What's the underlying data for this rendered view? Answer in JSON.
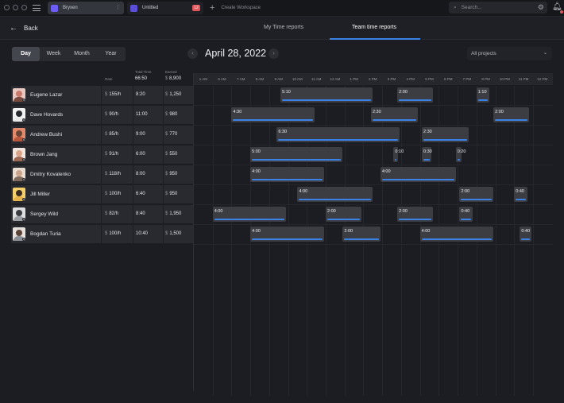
{
  "app": {
    "active_tab": "Bryxen",
    "other_tab": "Untitled",
    "other_tab_badge": "12",
    "create_workspace": "Create Workspace",
    "search_placeholder": "Search...",
    "colors": {
      "accent": "#3b82e6",
      "brand": "#6d5df5",
      "badge": "#e0565b"
    }
  },
  "nav": {
    "back_label": "Back",
    "tabs": [
      "My Time reports",
      "Team time reports"
    ],
    "active_tab": "Team time reports"
  },
  "controls": {
    "periods": [
      "Day",
      "Week",
      "Month",
      "Year"
    ],
    "active_period": "Day",
    "date": "April 28, 2022",
    "prev_icon": "chevron-left-icon",
    "next_icon": "chevron-right-icon",
    "project_filter": "All projects"
  },
  "table": {
    "headers": {
      "rate": "Rate",
      "total_time": "Total Time",
      "earned": "Earned"
    },
    "totals": {
      "total_time": "66:50",
      "earned_currency": "$",
      "earned": "8,900"
    },
    "currency": "$",
    "rows": [
      {
        "name": "Eugene Lazar",
        "rate": "155/h",
        "time": "8:20",
        "earned": "1,250",
        "avatar_colors": [
          "#c97a6a",
          "#7a4a3e",
          "#e8c8c0"
        ]
      },
      {
        "name": "Dave Hovards",
        "rate": "90/h",
        "time": "11:00",
        "earned": "980",
        "avatar_colors": [
          "#2a2b30",
          "#e9e9ea",
          "#f2f2f2"
        ]
      },
      {
        "name": "Andrew Bushi",
        "rate": "85/h",
        "time": "9:00",
        "earned": "770",
        "avatar_colors": [
          "#6a4536",
          "#b8573c",
          "#e38a6c"
        ]
      },
      {
        "name": "Brown Jang",
        "rate": "91/h",
        "time": "6:00",
        "earned": "550",
        "avatar_colors": [
          "#d9a488",
          "#9f6a53",
          "#f3e6de"
        ]
      },
      {
        "name": "Dmitry Kovalenko",
        "rate": "118/h",
        "time": "8:00",
        "earned": "950",
        "avatar_colors": [
          "#caa58c",
          "#806a5c",
          "#eaded3"
        ]
      },
      {
        "name": "Jill Miller",
        "rate": "100/h",
        "time": "6:40",
        "earned": "950",
        "avatar_colors": [
          "#3a2a20",
          "#e6b24a",
          "#f4cf6a"
        ]
      },
      {
        "name": "Sergey Wild",
        "rate": "82/h",
        "time": "8:40",
        "earned": "1,950",
        "avatar_colors": [
          "#3b3d42",
          "#9b9ea4",
          "#dedfe1"
        ]
      },
      {
        "name": "Bogdan Turia",
        "rate": "100/h",
        "time": "10:40",
        "earned": "1,500",
        "avatar_colors": [
          "#5b4338",
          "#8a8f96",
          "#e6e1dc"
        ]
      }
    ]
  },
  "timeline": {
    "hours": [
      "1 AM",
      "6 AM",
      "7 AM",
      "8 AM",
      "9 AM",
      "10 AM",
      "11 AM",
      "12 AM",
      "1 PM",
      "2 PM",
      "3 PM",
      "4 PM",
      "5 PM",
      "6 PM",
      "7 PM",
      "8 PM",
      "10 PM",
      "11 PM",
      "12 PM"
    ],
    "rows": [
      [
        {
          "label": "5:10",
          "start": 4.6,
          "end": 9.5
        },
        {
          "label": "2:00",
          "start": 10.8,
          "end": 12.7
        },
        {
          "label": "1:10",
          "start": 15.0,
          "end": 15.7
        }
      ],
      [
        {
          "label": "4:30",
          "start": 2.0,
          "end": 6.4
        },
        {
          "label": "2:30",
          "start": 9.4,
          "end": 11.9
        },
        {
          "label": "2:00",
          "start": 15.9,
          "end": 17.8
        }
      ],
      [
        {
          "label": "6:30",
          "start": 4.4,
          "end": 10.9
        },
        {
          "label": "2:30",
          "start": 12.1,
          "end": 14.6
        }
      ],
      [
        {
          "label": "5:00",
          "start": 3.0,
          "end": 7.9
        },
        {
          "label": "0:10",
          "start": 10.6,
          "end": 10.8
        },
        {
          "label": "0:30",
          "start": 12.1,
          "end": 12.6
        },
        {
          "label": "0:20",
          "start": 13.9,
          "end": 14.2
        }
      ],
      [
        {
          "label": "4:00",
          "start": 3.0,
          "end": 6.9
        },
        {
          "label": "4:00",
          "start": 9.9,
          "end": 13.9
        }
      ],
      [
        {
          "label": "4:00",
          "start": 5.5,
          "end": 9.5
        },
        {
          "label": "2:00",
          "start": 14.1,
          "end": 15.9
        },
        {
          "label": "0:40",
          "start": 17.0,
          "end": 17.7
        }
      ],
      [
        {
          "label": "4:00",
          "start": 1.0,
          "end": 4.9
        },
        {
          "label": "2:00",
          "start": 7.0,
          "end": 8.9
        },
        {
          "label": "2:00",
          "start": 10.8,
          "end": 12.7
        },
        {
          "label": "0:40",
          "start": 14.1,
          "end": 14.8
        }
      ],
      [
        {
          "label": "4:00",
          "start": 3.0,
          "end": 6.9
        },
        {
          "label": "2:00",
          "start": 7.9,
          "end": 9.9
        },
        {
          "label": "4:00",
          "start": 12.0,
          "end": 15.9
        },
        {
          "label": "0:40",
          "start": 17.3,
          "end": 17.9
        }
      ]
    ]
  }
}
